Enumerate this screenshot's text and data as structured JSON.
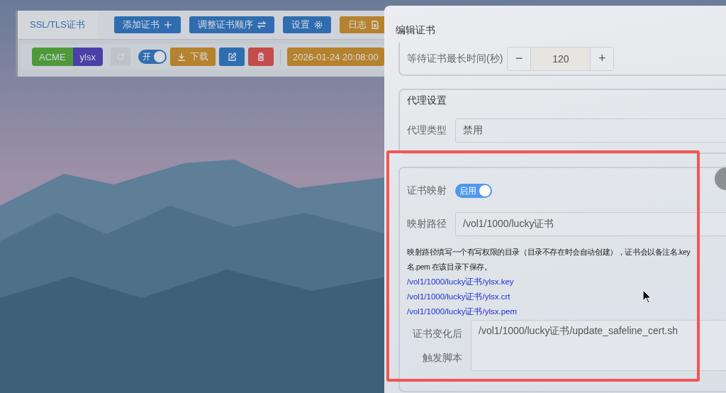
{
  "app": {
    "tabs": [
      {
        "label": "SSL/TLS证书",
        "selected": true
      }
    ],
    "actions": [
      {
        "label": "添加证书",
        "kind": "primary"
      },
      {
        "label": "调整证书顺序",
        "kind": "primary"
      },
      {
        "label": "设置",
        "kind": "primary"
      },
      {
        "label": "日志",
        "kind": "warning"
      }
    ],
    "cert": {
      "badges": [
        {
          "label": "ACME",
          "color": "#4e9a3b"
        },
        {
          "label": "ylsx",
          "color": "#4a40a8"
        }
      ],
      "toggle": {
        "label": "开",
        "on": true
      },
      "download": "下载",
      "date": "2026-01-24 20:08:00"
    }
  },
  "drawer": {
    "title": "编辑证书",
    "wait": {
      "label": "等待证书最长时间(秒)",
      "minus": "−",
      "value": "120",
      "plus": "+"
    },
    "proxy": {
      "title": "代理设置",
      "type_label": "代理类型",
      "type_value": "禁用"
    },
    "mapping": {
      "toggle_label": "证书映射",
      "toggle": {
        "text": "启用",
        "on": true
      },
      "path_label": "映射路径",
      "path_value": "/vol1/1000/lucky证书",
      "hint_lines": [
        "映射路径填写一个有写权限的目录（目录不存在时会自动创建），证书会以备注名.key",
        "名.pem 在该目录下保存。"
      ],
      "files": [
        "/vol1/1000/lucky证书/ylsx.key",
        "/vol1/1000/lucky证书/ylsx.crt",
        "/vol1/1000/lucky证书/ylsx.pem"
      ],
      "script_label_lines": [
        "证书变化后",
        "触发脚本"
      ],
      "script_value": "/vol1/1000/lucky证书/update_safeline_cert.sh"
    }
  }
}
